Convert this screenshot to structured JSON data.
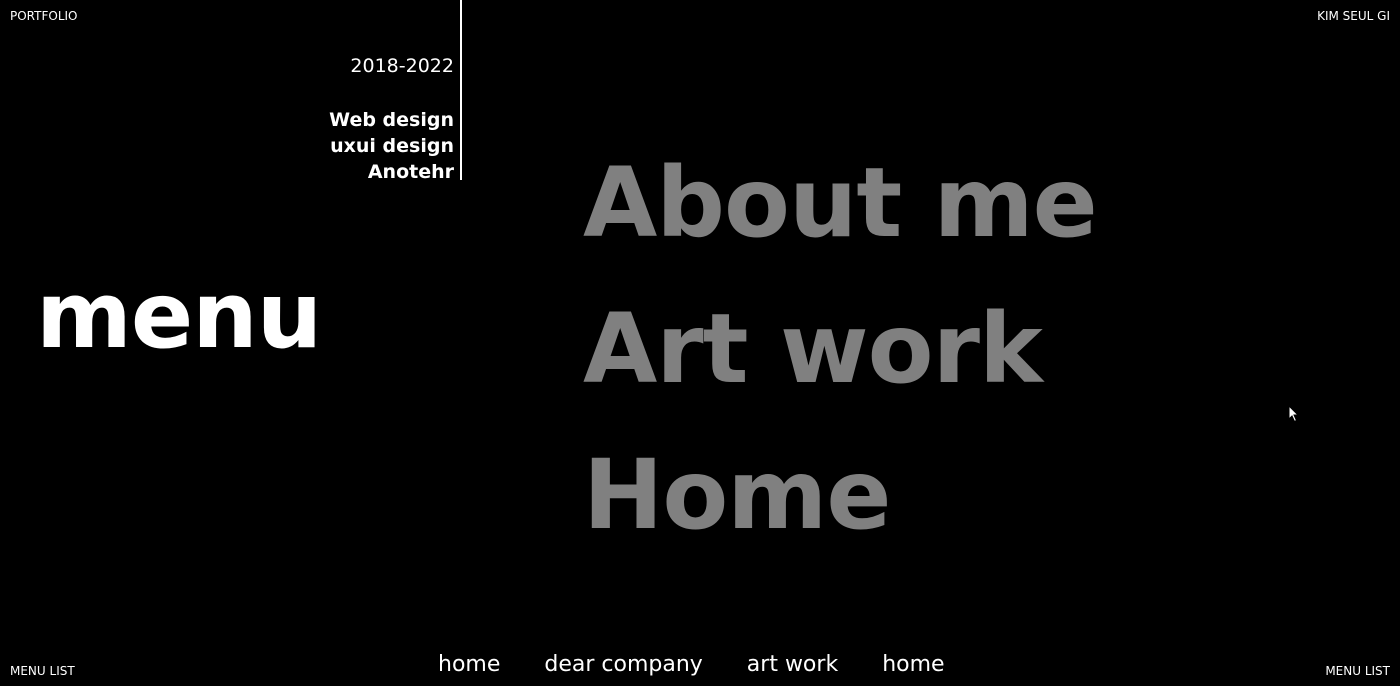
{
  "header": {
    "left_label": "PORTFOLIO",
    "right_label": "KIM SEUL GI"
  },
  "info": {
    "years": "2018-2022",
    "categories": [
      "Web design",
      "uxui design",
      "Anotehr"
    ]
  },
  "hero": {
    "title": "menu"
  },
  "main_menu": {
    "items": [
      "About me",
      "Art work",
      "Home"
    ],
    "color": "#808080"
  },
  "bottom_nav": {
    "items": [
      "home",
      "dear company",
      "art work",
      "home"
    ]
  },
  "footer": {
    "left_label": "MENU LIST",
    "right_label": "MENU LIST"
  },
  "colors": {
    "background": "#000000",
    "text": "#ffffff"
  }
}
